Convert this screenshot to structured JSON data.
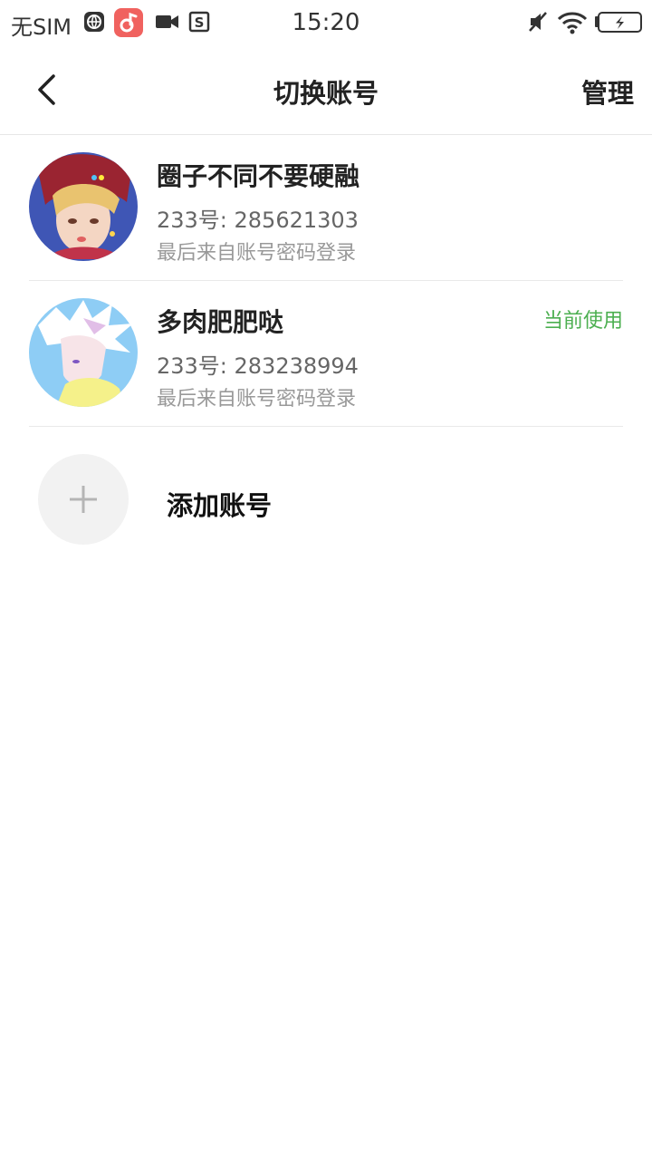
{
  "status_bar": {
    "carrier": "无SIM",
    "time": "15:20",
    "left_icons": [
      "browser-icon",
      "music-app-icon",
      "video-camera-icon",
      "s-app-icon"
    ],
    "right_icons": [
      "mute-icon",
      "wifi-icon",
      "battery-charging-icon"
    ]
  },
  "header": {
    "title": "切换账号",
    "manage_label": "管理"
  },
  "accounts": [
    {
      "name": "圈子不同不要硬融",
      "id_text": "233号: 285621303",
      "last_login": "最后来自账号密码登录",
      "current_label": ""
    },
    {
      "name": "多肉肥肥哒",
      "id_text": "233号: 283238994",
      "last_login": "最后来自账号密码登录",
      "current_label": "当前使用"
    }
  ],
  "add_account": {
    "label": "添加账号"
  },
  "colors": {
    "accent_green": "#4caf50",
    "divider": "#e9e9e9",
    "music_app_red": "#f0625f"
  }
}
